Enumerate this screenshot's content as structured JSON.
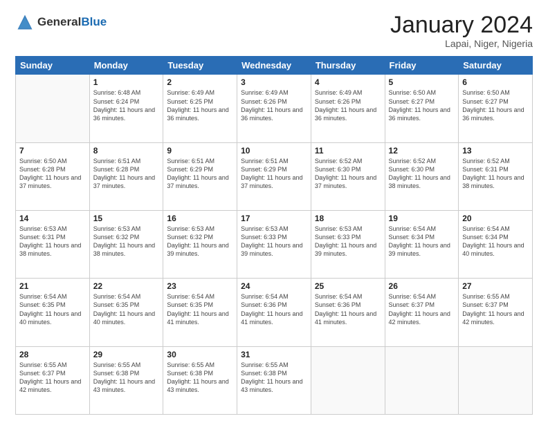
{
  "header": {
    "logo_general": "General",
    "logo_blue": "Blue",
    "month_year": "January 2024",
    "location": "Lapai, Niger, Nigeria"
  },
  "days_of_week": [
    "Sunday",
    "Monday",
    "Tuesday",
    "Wednesday",
    "Thursday",
    "Friday",
    "Saturday"
  ],
  "weeks": [
    [
      {
        "day": "",
        "sunrise": "",
        "sunset": "",
        "daylight": "",
        "empty": true
      },
      {
        "day": "1",
        "sunrise": "6:48 AM",
        "sunset": "6:24 PM",
        "daylight": "11 hours and 36 minutes."
      },
      {
        "day": "2",
        "sunrise": "6:49 AM",
        "sunset": "6:25 PM",
        "daylight": "11 hours and 36 minutes."
      },
      {
        "day": "3",
        "sunrise": "6:49 AM",
        "sunset": "6:26 PM",
        "daylight": "11 hours and 36 minutes."
      },
      {
        "day": "4",
        "sunrise": "6:49 AM",
        "sunset": "6:26 PM",
        "daylight": "11 hours and 36 minutes."
      },
      {
        "day": "5",
        "sunrise": "6:50 AM",
        "sunset": "6:27 PM",
        "daylight": "11 hours and 36 minutes."
      },
      {
        "day": "6",
        "sunrise": "6:50 AM",
        "sunset": "6:27 PM",
        "daylight": "11 hours and 36 minutes."
      }
    ],
    [
      {
        "day": "7",
        "sunrise": "6:50 AM",
        "sunset": "6:28 PM",
        "daylight": "11 hours and 37 minutes."
      },
      {
        "day": "8",
        "sunrise": "6:51 AM",
        "sunset": "6:28 PM",
        "daylight": "11 hours and 37 minutes."
      },
      {
        "day": "9",
        "sunrise": "6:51 AM",
        "sunset": "6:29 PM",
        "daylight": "11 hours and 37 minutes."
      },
      {
        "day": "10",
        "sunrise": "6:51 AM",
        "sunset": "6:29 PM",
        "daylight": "11 hours and 37 minutes."
      },
      {
        "day": "11",
        "sunrise": "6:52 AM",
        "sunset": "6:30 PM",
        "daylight": "11 hours and 37 minutes."
      },
      {
        "day": "12",
        "sunrise": "6:52 AM",
        "sunset": "6:30 PM",
        "daylight": "11 hours and 38 minutes."
      },
      {
        "day": "13",
        "sunrise": "6:52 AM",
        "sunset": "6:31 PM",
        "daylight": "11 hours and 38 minutes."
      }
    ],
    [
      {
        "day": "14",
        "sunrise": "6:53 AM",
        "sunset": "6:31 PM",
        "daylight": "11 hours and 38 minutes."
      },
      {
        "day": "15",
        "sunrise": "6:53 AM",
        "sunset": "6:32 PM",
        "daylight": "11 hours and 38 minutes."
      },
      {
        "day": "16",
        "sunrise": "6:53 AM",
        "sunset": "6:32 PM",
        "daylight": "11 hours and 39 minutes."
      },
      {
        "day": "17",
        "sunrise": "6:53 AM",
        "sunset": "6:33 PM",
        "daylight": "11 hours and 39 minutes."
      },
      {
        "day": "18",
        "sunrise": "6:53 AM",
        "sunset": "6:33 PM",
        "daylight": "11 hours and 39 minutes."
      },
      {
        "day": "19",
        "sunrise": "6:54 AM",
        "sunset": "6:34 PM",
        "daylight": "11 hours and 39 minutes."
      },
      {
        "day": "20",
        "sunrise": "6:54 AM",
        "sunset": "6:34 PM",
        "daylight": "11 hours and 40 minutes."
      }
    ],
    [
      {
        "day": "21",
        "sunrise": "6:54 AM",
        "sunset": "6:35 PM",
        "daylight": "11 hours and 40 minutes."
      },
      {
        "day": "22",
        "sunrise": "6:54 AM",
        "sunset": "6:35 PM",
        "daylight": "11 hours and 40 minutes."
      },
      {
        "day": "23",
        "sunrise": "6:54 AM",
        "sunset": "6:35 PM",
        "daylight": "11 hours and 41 minutes."
      },
      {
        "day": "24",
        "sunrise": "6:54 AM",
        "sunset": "6:36 PM",
        "daylight": "11 hours and 41 minutes."
      },
      {
        "day": "25",
        "sunrise": "6:54 AM",
        "sunset": "6:36 PM",
        "daylight": "11 hours and 41 minutes."
      },
      {
        "day": "26",
        "sunrise": "6:54 AM",
        "sunset": "6:37 PM",
        "daylight": "11 hours and 42 minutes."
      },
      {
        "day": "27",
        "sunrise": "6:55 AM",
        "sunset": "6:37 PM",
        "daylight": "11 hours and 42 minutes."
      }
    ],
    [
      {
        "day": "28",
        "sunrise": "6:55 AM",
        "sunset": "6:37 PM",
        "daylight": "11 hours and 42 minutes."
      },
      {
        "day": "29",
        "sunrise": "6:55 AM",
        "sunset": "6:38 PM",
        "daylight": "11 hours and 43 minutes."
      },
      {
        "day": "30",
        "sunrise": "6:55 AM",
        "sunset": "6:38 PM",
        "daylight": "11 hours and 43 minutes."
      },
      {
        "day": "31",
        "sunrise": "6:55 AM",
        "sunset": "6:38 PM",
        "daylight": "11 hours and 43 minutes."
      },
      {
        "day": "",
        "sunrise": "",
        "sunset": "",
        "daylight": "",
        "empty": true
      },
      {
        "day": "",
        "sunrise": "",
        "sunset": "",
        "daylight": "",
        "empty": true
      },
      {
        "day": "",
        "sunrise": "",
        "sunset": "",
        "daylight": "",
        "empty": true
      }
    ]
  ],
  "labels": {
    "sunrise": "Sunrise:",
    "sunset": "Sunset:",
    "daylight": "Daylight:"
  }
}
